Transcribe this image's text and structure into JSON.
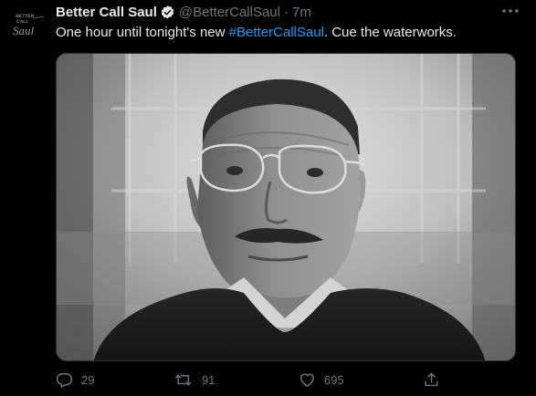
{
  "tweet": {
    "display_name": "Better Call Saul",
    "handle": "@BetterCallSaul",
    "separator": "·",
    "timestamp": "7m",
    "verified": true,
    "text_before": "One hour until tonight's new ",
    "hashtag": "#BetterCallSaul",
    "text_after": ". Cue the waterworks.",
    "avatar_logo_lines": [
      "BETTER",
      "CALL",
      "Saul"
    ],
    "media_alt": "Black-and-white photo of a man wearing wire-rimmed glasses and a dark sweater over a collared shirt"
  },
  "actions": {
    "reply_count": "29",
    "retweet_count": "91",
    "like_count": "695"
  },
  "icons": {
    "more": "more-icon",
    "verified": "verified-badge-icon",
    "reply": "reply-icon",
    "retweet": "retweet-icon",
    "like": "heart-icon",
    "share": "share-icon"
  },
  "colors": {
    "background": "#000000",
    "text": "#e7e9ea",
    "secondary": "#71767b",
    "accent": "#1d9bf0"
  }
}
